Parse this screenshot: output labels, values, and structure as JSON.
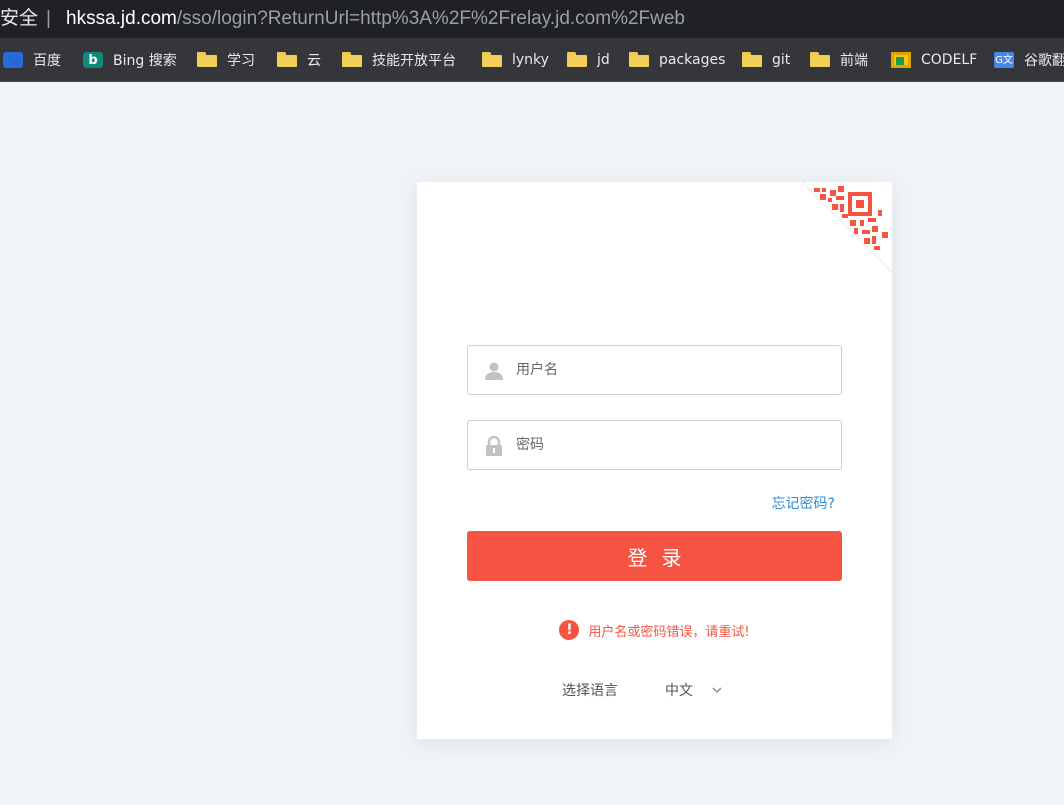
{
  "address_bar": {
    "security_label": "安全",
    "separator": "|",
    "host": "hkssa.jd.com",
    "path": "/sso/login?ReturnUrl=http%3A%2F%2Frelay.jd.com%2Fweb"
  },
  "bookmarks": [
    {
      "label": "百度",
      "icon": "baidu-icon"
    },
    {
      "label": "Bing 搜索",
      "icon": "bing-icon"
    },
    {
      "label": "学习",
      "icon": "folder-icon"
    },
    {
      "label": "云",
      "icon": "folder-icon"
    },
    {
      "label": "技能开放平台",
      "icon": "folder-icon"
    },
    {
      "label": "lynky",
      "icon": "folder-icon"
    },
    {
      "label": "jd",
      "icon": "folder-icon"
    },
    {
      "label": "packages",
      "icon": "folder-icon"
    },
    {
      "label": "git",
      "icon": "folder-icon"
    },
    {
      "label": "前端",
      "icon": "folder-icon"
    },
    {
      "label": "CODELF",
      "icon": "codelf-icon"
    },
    {
      "label": "谷歌翻",
      "icon": "google-translate-icon"
    }
  ],
  "login": {
    "username_placeholder": "用户名",
    "username_value": "",
    "password_placeholder": "密码",
    "password_value": "",
    "forgot_password": "忘记密码?",
    "login_button": "登录",
    "error_message": "用户名或密码错误，请重试!",
    "language_label": "选择语言",
    "language_selected": "中文"
  },
  "colors": {
    "accent": "#f65442",
    "link": "#2b8ddb",
    "page_background": "#f0f4f8",
    "bookmarks_bar": "#35363a"
  }
}
